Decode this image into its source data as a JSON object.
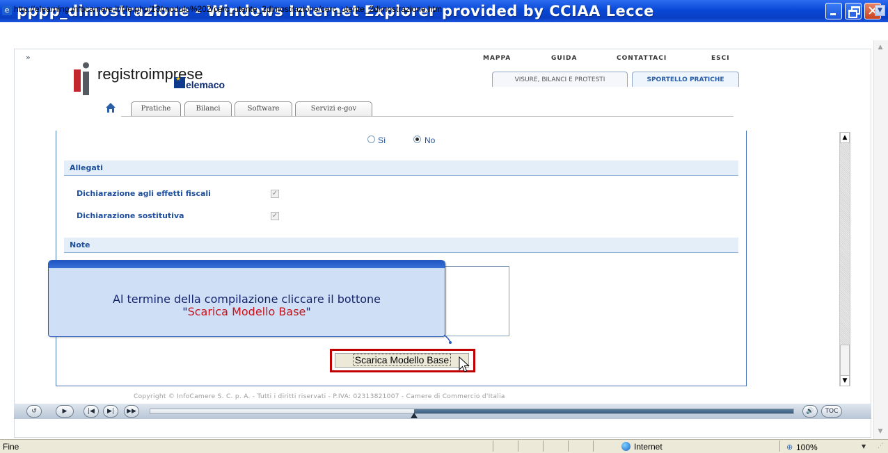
{
  "window": {
    "title": "pppp_dimostrazione - Windows Internet Explorer provided by CCIAA Lecce",
    "url": "http://elearning.infocamere.it/file.php/13/modulo%202/cerc_utente_2dimostrazione/cerc_utente_2dimostrazione.htm"
  },
  "player": {
    "expand_glyph": "»"
  },
  "site": {
    "logo_text": "registroimprese",
    "telemaco_text": "elemaco",
    "top_links": [
      "MAPPA",
      "GUIDA",
      "CONTATTACI",
      "ESCI"
    ],
    "service_tabs": [
      "VISURE, BILANCI E PROTESTI",
      "SPORTELLO PRATICHE"
    ],
    "nav_tabs": [
      "Pratiche",
      "Bilanci",
      "Software",
      "Servizi e-gov"
    ]
  },
  "form": {
    "radio_options": [
      {
        "label": "Sì",
        "selected": false
      },
      {
        "label": "No",
        "selected": true
      }
    ],
    "sections": {
      "attachments_title": "Allegati",
      "notes_title": "Note"
    },
    "attachments": [
      {
        "label": "Dichiarazione agli effetti fiscali",
        "checked": true
      },
      {
        "label": "Dichiarazione sostitutiva",
        "checked": true
      }
    ],
    "download_button": "Scarica Modello Base",
    "copyright": "Copyright © InfoCamere S. C. p. A. - Tutti i diritti riservati - P.IVA: 02313821007 - Camere di Commercio d'Italia"
  },
  "callout": {
    "line1": "Al termine della compilazione cliccare il bottone",
    "quote_open": "\"",
    "highlight": "Scarica Modello Base",
    "quote_close": "\""
  },
  "player_controls": {
    "progress": 0.41,
    "buttons": [
      "replay",
      "play",
      "previous-slide",
      "next-slide",
      "forward"
    ],
    "right_buttons": [
      "audio",
      "toc"
    ],
    "labels": {
      "toc": "TOC"
    }
  },
  "statusbar": {
    "status": "Fine",
    "zone": "Internet",
    "zoom": "100%"
  },
  "colors": {
    "title_bar": "#0a3fc4",
    "section_bar": "#e4eef8",
    "label_blue": "#1e4f9c",
    "highlight_red": "#c8121a",
    "button_outline": "#c00000"
  },
  "icons": {
    "title": "ie-icon",
    "home": "home-icon",
    "cursor": "mouse-pointer-icon"
  }
}
